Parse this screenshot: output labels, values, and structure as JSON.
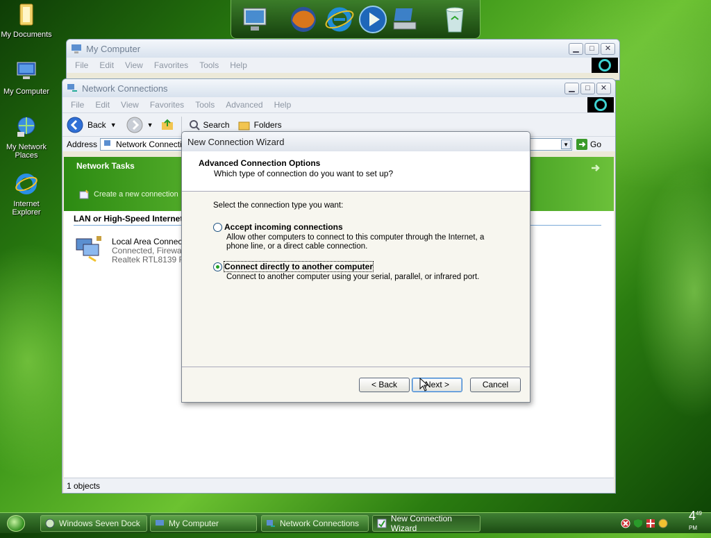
{
  "desktop": {
    "icons": [
      {
        "label": "My Documents"
      },
      {
        "label": "My Computer"
      },
      {
        "label": "My Network Places"
      },
      {
        "label": "Internet Explorer"
      }
    ]
  },
  "dock": {
    "items": [
      "monitor-icon",
      "firefox-icon",
      "ie-icon",
      "media-player-icon",
      "network-drive-icon",
      "recycle-bin-icon"
    ]
  },
  "my_computer_window": {
    "title": "My Computer",
    "menu": [
      "File",
      "Edit",
      "View",
      "Favorites",
      "Tools",
      "Help"
    ]
  },
  "network_window": {
    "title": "Network Connections",
    "menu": [
      "File",
      "Edit",
      "View",
      "Favorites",
      "Tools",
      "Advanced",
      "Help"
    ],
    "toolbar": {
      "back": "Back",
      "search": "Search",
      "folders": "Folders"
    },
    "address_label": "Address",
    "address_value": "Network Connections",
    "go_label": "Go",
    "network_tasks_title": "Network Tasks",
    "create_connection": "Create a new connection",
    "lan_header": "LAN or High-Speed Internet",
    "connection": {
      "name": "Local Area Connection",
      "status": "Connected, Firewalled",
      "device": "Realtek RTL8139 Family"
    },
    "status": "1 objects"
  },
  "wizard": {
    "title": "New Connection Wizard",
    "header_title": "Advanced Connection Options",
    "header_subtitle": "Which type of connection do you want to set up?",
    "prompt": "Select the connection type you want:",
    "options": [
      {
        "label": "Accept incoming connections",
        "description": "Allow other computers to connect to this computer through the Internet, a phone line, or a direct cable connection.",
        "selected": false
      },
      {
        "label": "Connect directly to another computer",
        "description": "Connect to another computer using your serial, parallel, or infrared port.",
        "selected": true
      }
    ],
    "buttons": {
      "back": "< Back",
      "next": "Next >",
      "cancel": "Cancel"
    }
  },
  "taskbar": {
    "tasks": [
      {
        "label": "Windows Seven Dock"
      },
      {
        "label": "My Computer"
      },
      {
        "label": "Network Connections"
      },
      {
        "label": "New Connection Wizard"
      }
    ],
    "clock_hour": "4",
    "clock_minute": "49",
    "clock_ampm": "PM"
  }
}
